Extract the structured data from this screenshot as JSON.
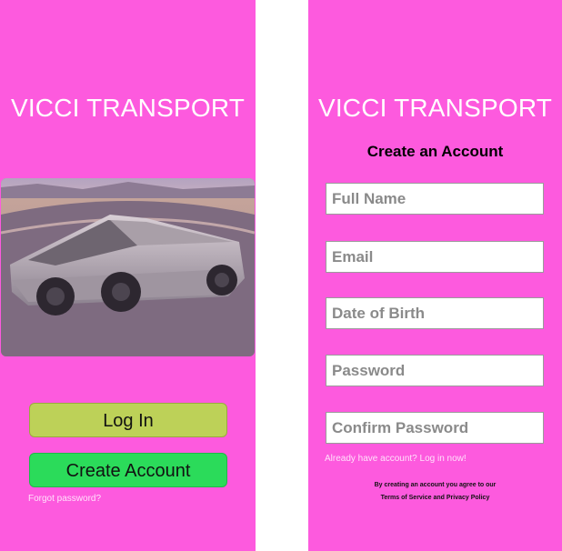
{
  "login_screen": {
    "brand": "VICCI TRANSPORT",
    "photo_alt": "cybertruck-photo",
    "login_button": "Log In",
    "create_button": "Create Account",
    "forgot_link": "Forgot password?"
  },
  "signup_screen": {
    "brand": "VICCI TRANSPORT",
    "heading": "Create an Account",
    "fields": [
      {
        "placeholder": "Full Name"
      },
      {
        "placeholder": "Email"
      },
      {
        "placeholder": "Date of Birth"
      },
      {
        "placeholder": "Password"
      },
      {
        "placeholder": "Confirm Password"
      }
    ],
    "login_link": "Already have account? Log in now!",
    "terms_line1": "By creating an account you agree to our",
    "terms_line2": "Terms of Service and Privacy Policy"
  },
  "colors": {
    "background": "#fd5ade",
    "login_button": "#bdd158",
    "create_button": "#2bdb5a"
  }
}
